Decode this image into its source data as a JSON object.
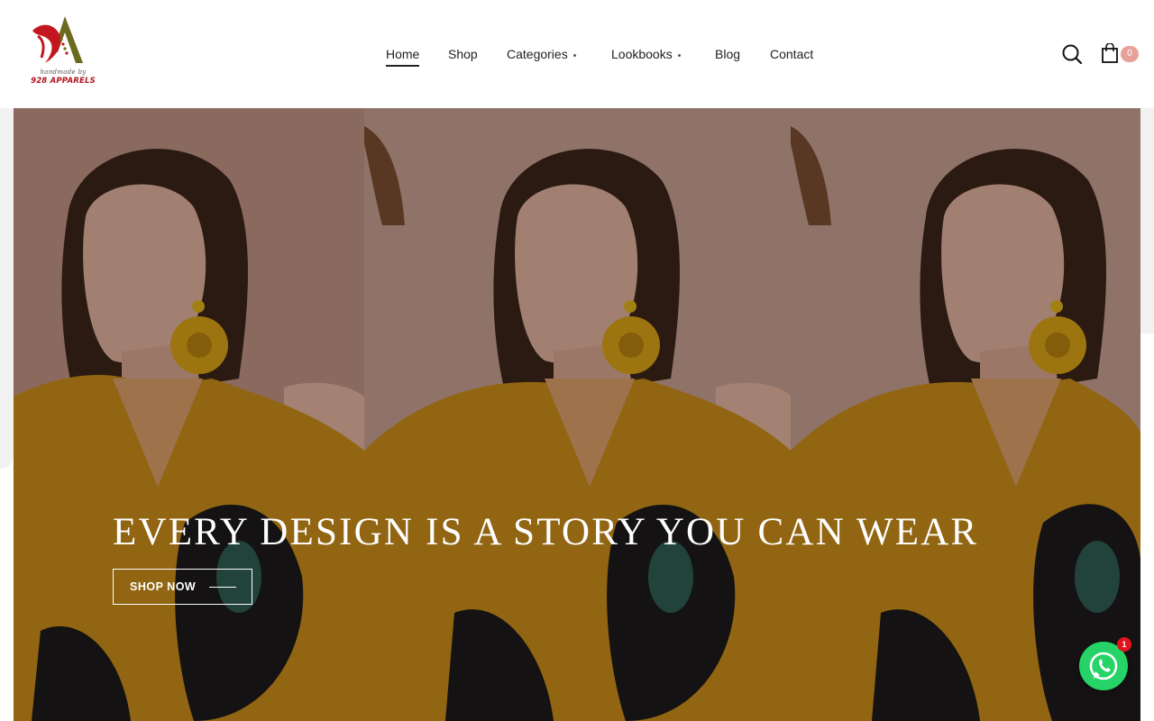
{
  "brand": {
    "logo_tagline": "handmade by",
    "logo_name": "928 APPARELS",
    "colors": {
      "red": "#b3141d",
      "olive": "#6b6a1e",
      "badge": "#e8a198",
      "whatsapp": "#25d366"
    }
  },
  "nav": {
    "items": [
      {
        "label": "Home",
        "active": true
      },
      {
        "label": "Shop"
      },
      {
        "label": "Categories",
        "has_dropdown": true
      },
      {
        "label": "Lookbooks",
        "has_dropdown": true
      },
      {
        "label": "Blog"
      },
      {
        "label": "Contact"
      }
    ]
  },
  "header_actions": {
    "search_icon": "search-icon",
    "cart_icon": "shopping-bag-icon",
    "cart_count": "0"
  },
  "hero": {
    "title": "EVERY DESIGN IS A STORY YOU CAN WEAR",
    "cta_label": "SHOP NOW"
  },
  "whatsapp": {
    "icon": "whatsapp-icon",
    "badge_count": "1"
  }
}
